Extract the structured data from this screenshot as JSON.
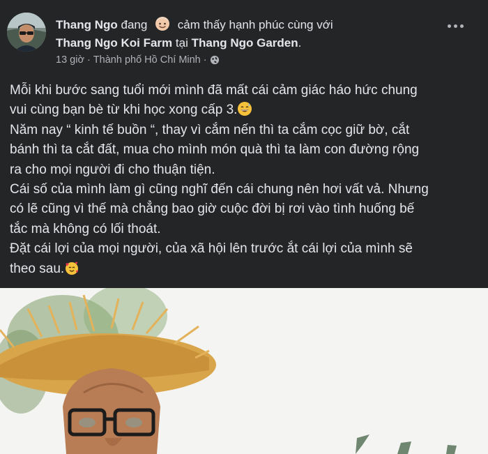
{
  "post": {
    "author": "Thang Ngo",
    "status_word": "đang",
    "feeling_text": "cảm thấy hạnh phúc cùng với",
    "tagged_page": "Thang Ngo Koi Farm",
    "location_prep": "tại",
    "location_name": "Thang Ngo Garden",
    "location_end": ".",
    "time": "13 giờ",
    "separator": "·",
    "city": "Thành phố Hồ Chí Minh",
    "separator2": "·",
    "audience_icon": "globe-icon",
    "feeling_icon": "happy-face-icon",
    "more_icon": "more-options-icon",
    "lines": [
      "Mỗi khi bước sang tuổi mới mình đã mất cái cảm giác háo hức chung",
      "vui cùng bạn bè từ khi học xong cấp 3.",
      "Năm nay “ kinh tế buồn “, thay vì cắm nến thì ta cắm cọc giữ bờ, cắt",
      "bánh thì ta cắt đất, mua cho mình món quà thì ta làm con đường rộng",
      "ra cho mọi người đi cho thuận tiện.",
      "Cái số của mình làm gì cũng nghĩ đến cái chung nên hơi vất vả. Nhưng",
      "có lẽ cũng vì thế mà chẳng bao giờ cuộc đời bị rơi vào tình huống bế",
      "tắc mà không có lối thoát.",
      "Đặt cái lợi của mọi người, của xã hội lên trước ắt cái lợi của mình sẽ",
      "theo sau."
    ],
    "emoji_line2": "grinning-sweat-emoji",
    "emoji_line10": "smiling-hearts-emoji"
  },
  "colors": {
    "background": "#242526",
    "text_primary": "#e4e6eb",
    "text_secondary": "#b0b3b8"
  }
}
